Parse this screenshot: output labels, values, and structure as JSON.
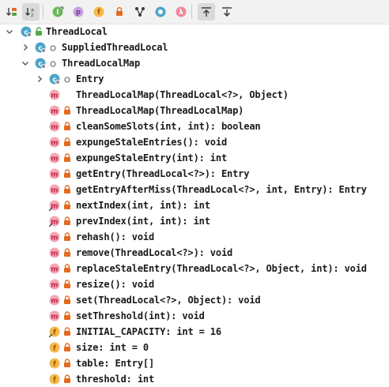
{
  "toolbar": {
    "buttons": [
      {
        "icon": "sort-by-visibility-icon",
        "active": false
      },
      {
        "icon": "sort-alphabetically-icon",
        "active": true
      },
      {
        "icon": "show-inherited-icon",
        "active": false
      },
      {
        "icon": "show-properties-icon",
        "active": false
      },
      {
        "icon": "show-fields-icon",
        "active": false
      },
      {
        "icon": "show-non-public-icon",
        "active": false
      },
      {
        "icon": "show-inheritance-tree-icon",
        "active": false
      },
      {
        "icon": "show-anonymous-classes-icon",
        "active": false
      },
      {
        "icon": "show-lambdas-icon",
        "active": false
      },
      {
        "icon": "autoscroll-to-source-icon",
        "active": true
      },
      {
        "icon": "autoscroll-from-source-icon",
        "active": false
      }
    ]
  },
  "tree": [
    {
      "depth": 0,
      "arrow": "down",
      "icon": "class",
      "vis": "public",
      "label": "ThreadLocal"
    },
    {
      "depth": 1,
      "arrow": "right",
      "icon": "class",
      "vis": "package",
      "label": "SuppliedThreadLocal"
    },
    {
      "depth": 1,
      "arrow": "down",
      "icon": "class",
      "vis": "package",
      "label": "ThreadLocalMap"
    },
    {
      "depth": 2,
      "arrow": "right",
      "icon": "class",
      "vis": "package",
      "label": "Entry"
    },
    {
      "depth": 2,
      "icon": "method",
      "vis": "none",
      "label": "ThreadLocalMap(ThreadLocal<?>, Object)"
    },
    {
      "depth": 2,
      "icon": "method",
      "vis": "private",
      "label": "ThreadLocalMap(ThreadLocalMap)"
    },
    {
      "depth": 2,
      "icon": "method",
      "vis": "private",
      "label": "cleanSomeSlots(int, int): boolean"
    },
    {
      "depth": 2,
      "icon": "method",
      "vis": "private",
      "label": "expungeStaleEntries(): void"
    },
    {
      "depth": 2,
      "icon": "method",
      "vis": "private",
      "label": "expungeStaleEntry(int): int"
    },
    {
      "depth": 2,
      "icon": "method",
      "vis": "private",
      "label": "getEntry(ThreadLocal<?>): Entry"
    },
    {
      "depth": 2,
      "icon": "method",
      "vis": "private",
      "label": "getEntryAfterMiss(ThreadLocal<?>, int, Entry): Entry"
    },
    {
      "depth": 2,
      "icon": "method-static",
      "vis": "private",
      "label": "nextIndex(int, int): int"
    },
    {
      "depth": 2,
      "icon": "method-static",
      "vis": "private",
      "label": "prevIndex(int, int): int"
    },
    {
      "depth": 2,
      "icon": "method",
      "vis": "private",
      "label": "rehash(): void"
    },
    {
      "depth": 2,
      "icon": "method",
      "vis": "private",
      "label": "remove(ThreadLocal<?>): void"
    },
    {
      "depth": 2,
      "icon": "method",
      "vis": "private",
      "label": "replaceStaleEntry(ThreadLocal<?>, Object, int): void"
    },
    {
      "depth": 2,
      "icon": "method",
      "vis": "private",
      "label": "resize(): void"
    },
    {
      "depth": 2,
      "icon": "method",
      "vis": "private",
      "label": "set(ThreadLocal<?>, Object): void"
    },
    {
      "depth": 2,
      "icon": "method",
      "vis": "private",
      "label": "setThreshold(int): void"
    },
    {
      "depth": 2,
      "icon": "field-static",
      "vis": "private",
      "label": "INITIAL_CAPACITY: int = 16"
    },
    {
      "depth": 2,
      "icon": "field",
      "vis": "private",
      "label": "size: int = 0"
    },
    {
      "depth": 2,
      "icon": "field",
      "vis": "private",
      "label": "table: Entry[]"
    },
    {
      "depth": 2,
      "icon": "field",
      "vis": "private",
      "label": "threshold: int"
    }
  ],
  "colors": {
    "class_bg": "#4ea3c9",
    "method_bg": "#f3a7b3",
    "method_fg": "#c02a4a",
    "field_bg": "#f5b84a",
    "field_fg": "#a05800",
    "lock": "#e46a1f",
    "public_lock": "#55a84b"
  }
}
